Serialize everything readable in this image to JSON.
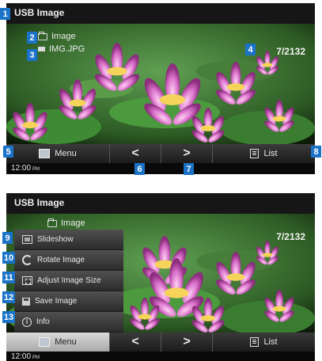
{
  "screen1": {
    "title": "USB Image",
    "folder": "Image",
    "file": "IMG.JPG",
    "counter": "7/2132",
    "menu_label": "Menu",
    "prev_label": "<",
    "next_label": ">",
    "list_label": "List",
    "clock": "12:00",
    "ampm": "PM"
  },
  "screen2": {
    "title": "USB Image",
    "folder": "Image",
    "counter": "7/2132",
    "menu_label": "Menu",
    "prev_label": "<",
    "next_label": ">",
    "list_label": "List",
    "clock": "12:00",
    "ampm": "PM",
    "menu_items": [
      {
        "label": "Slideshow",
        "icon": "slideshow-icon"
      },
      {
        "label": "Rotate Image",
        "icon": "rotate-icon"
      },
      {
        "label": "Adjust Image Size",
        "icon": "resize-icon"
      },
      {
        "label": "Save Image",
        "icon": "save-icon"
      },
      {
        "label": "Info",
        "icon": "info-icon"
      }
    ]
  },
  "callouts": [
    "1",
    "2",
    "3",
    "4",
    "5",
    "6",
    "7",
    "8",
    "9",
    "10",
    "11",
    "12",
    "13"
  ],
  "colors": {
    "callout": "#1a73c8",
    "screen_bg": "#0c0c0c",
    "petal": "#e08ad6",
    "leaf": "#3f8a34"
  }
}
